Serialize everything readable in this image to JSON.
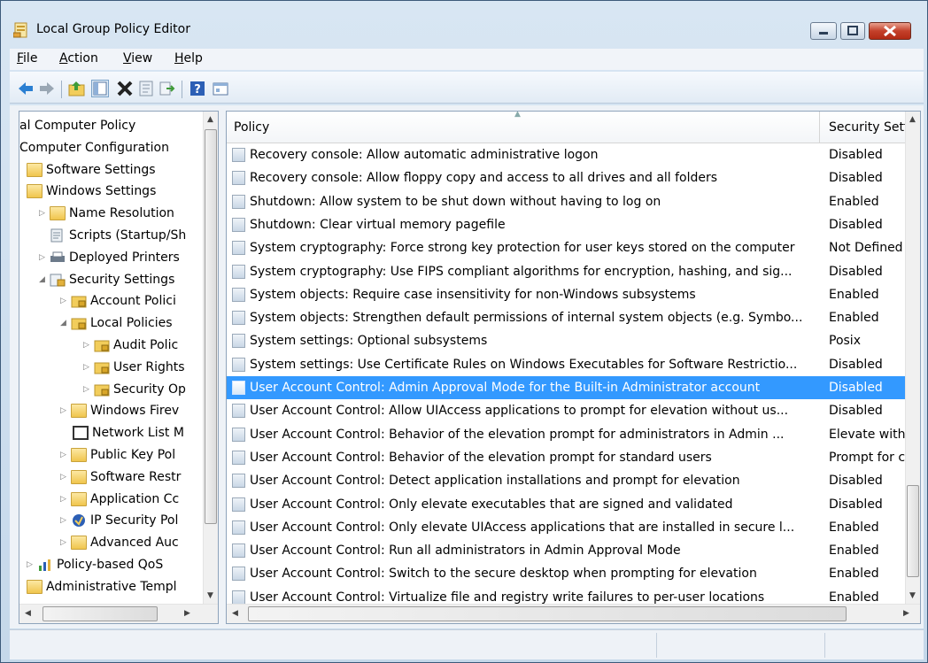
{
  "window": {
    "title": "Local Group Policy Editor"
  },
  "menu": [
    {
      "label": "File",
      "accel": "F",
      "rest": "ile"
    },
    {
      "label": "Action",
      "accel": "A",
      "rest": "ction"
    },
    {
      "label": "View",
      "accel": "V",
      "rest": "iew"
    },
    {
      "label": "Help",
      "accel": "H",
      "rest": "elp"
    }
  ],
  "toolbar": [
    "back-icon",
    "forward-icon",
    "up-folder-icon",
    "show-hide-tree-icon",
    "delete-icon",
    "properties-icon",
    "export-list-icon",
    "help-icon",
    "console-view-icon"
  ],
  "tree": {
    "nodes": [
      {
        "label": "al Computer Policy",
        "expander": "",
        "icon": "none"
      },
      {
        "label": "Computer Configuration",
        "expander": "",
        "icon": "none"
      },
      {
        "label": "Software Settings",
        "expander": "",
        "icon": "folder"
      },
      {
        "label": "Windows Settings",
        "expander": "",
        "icon": "folder"
      },
      {
        "label": "Name Resolution",
        "expander": "▷",
        "icon": "folder"
      },
      {
        "label": "Scripts (Startup/Sh",
        "expander": "",
        "icon": "script"
      },
      {
        "label": "Deployed Printers",
        "expander": "▷",
        "icon": "printer"
      },
      {
        "label": "Security Settings",
        "expander": "◢",
        "icon": "security"
      },
      {
        "label": "Account Polici",
        "expander": "▷",
        "icon": "folder-lock"
      },
      {
        "label": "Local Policies",
        "expander": "◢",
        "icon": "folder-lock"
      },
      {
        "label": "Audit Polic",
        "expander": "▷",
        "icon": "folder-lock"
      },
      {
        "label": "User Rights",
        "expander": "▷",
        "icon": "folder-lock"
      },
      {
        "label": "Security Op",
        "expander": "▷",
        "icon": "folder-lock"
      },
      {
        "label": "Windows Firev",
        "expander": "▷",
        "icon": "folder"
      },
      {
        "label": "Network List M",
        "expander": "",
        "icon": "doc"
      },
      {
        "label": "Public Key Pol",
        "expander": "▷",
        "icon": "folder"
      },
      {
        "label": "Software Restr",
        "expander": "▷",
        "icon": "folder"
      },
      {
        "label": "Application Cc",
        "expander": "▷",
        "icon": "folder"
      },
      {
        "label": "IP Security Pol",
        "expander": "▷",
        "icon": "shield"
      },
      {
        "label": "Advanced Auc",
        "expander": "▷",
        "icon": "folder"
      },
      {
        "label": "Policy-based QoS",
        "expander": "▷",
        "icon": "chart"
      },
      {
        "label": "Administrative Templ",
        "expander": "",
        "icon": "folder"
      }
    ]
  },
  "list": {
    "columns": {
      "policy": "Policy",
      "setting": "Security Settin"
    },
    "rows": [
      {
        "policy": "Recovery console: Allow automatic administrative logon",
        "setting": "Disabled"
      },
      {
        "policy": "Recovery console: Allow floppy copy and access to all drives and all folders",
        "setting": "Disabled"
      },
      {
        "policy": "Shutdown: Allow system to be shut down without having to log on",
        "setting": "Enabled"
      },
      {
        "policy": "Shutdown: Clear virtual memory pagefile",
        "setting": "Disabled"
      },
      {
        "policy": "System cryptography: Force strong key protection for user keys stored on the computer",
        "setting": "Not Defined"
      },
      {
        "policy": "System cryptography: Use FIPS compliant algorithms for encryption, hashing, and sig...",
        "setting": "Disabled"
      },
      {
        "policy": "System objects: Require case insensitivity for non-Windows subsystems",
        "setting": "Enabled"
      },
      {
        "policy": "System objects: Strengthen default permissions of internal system objects (e.g. Symbo...",
        "setting": "Enabled"
      },
      {
        "policy": "System settings: Optional subsystems",
        "setting": "Posix"
      },
      {
        "policy": "System settings: Use Certificate Rules on Windows Executables for Software Restrictio...",
        "setting": "Disabled"
      },
      {
        "policy": "User Account Control: Admin Approval Mode for the Built-in Administrator account",
        "setting": "Disabled",
        "selected": true
      },
      {
        "policy": "User Account Control: Allow UIAccess applications to prompt for elevation without us...",
        "setting": "Disabled"
      },
      {
        "policy": "User Account Control: Behavior of the elevation prompt for administrators in Admin ...",
        "setting": "Elevate witho"
      },
      {
        "policy": "User Account Control: Behavior of the elevation prompt for standard users",
        "setting": "Prompt for cr"
      },
      {
        "policy": "User Account Control: Detect application installations and prompt for elevation",
        "setting": "Disabled"
      },
      {
        "policy": "User Account Control: Only elevate executables that are signed and validated",
        "setting": "Disabled"
      },
      {
        "policy": "User Account Control: Only elevate UIAccess applications that are installed in secure l...",
        "setting": "Enabled"
      },
      {
        "policy": "User Account Control: Run all administrators in Admin Approval Mode",
        "setting": "Enabled"
      },
      {
        "policy": "User Account Control: Switch to the secure desktop when prompting for elevation",
        "setting": "Enabled"
      },
      {
        "policy": "User Account Control: Virtualize file and registry write failures to per-user locations",
        "setting": "Enabled"
      }
    ]
  },
  "colors": {
    "selection": "#3399ff",
    "frame": "#c5d8ea",
    "close": "#c4402a"
  }
}
